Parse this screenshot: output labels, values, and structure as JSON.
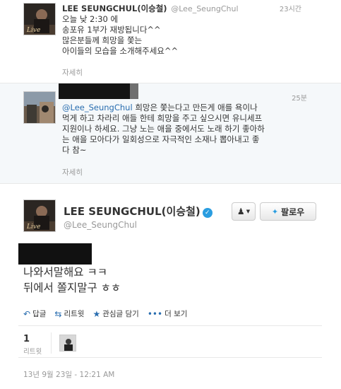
{
  "tweet1": {
    "name": "LEE SEUNGCHUL(이승철)",
    "handle": "@Lee_SeungChul",
    "time": "23시간",
    "lines": [
      "오늘 낮 2:30 에",
      "송포유 1부가 재방됩니다^^",
      "많은분들께 희망을 쫓는",
      "아이들의 모습을 소개해주세요^^"
    ],
    "more": "자세히"
  },
  "tweet2": {
    "time": "25분",
    "mention": "@Lee_SeungChul",
    "line1_rest": " 희망은 쫓는다고 만든게 애를 욕이나",
    "lines": [
      "먹게 하고 차라리 애들 한테 희망을 주고 싶으시면 유니세프",
      "지원이나 하세요. 그냥 노는 애을 중에서도 노래 하기 좋아하",
      "는 애을 모아다가 일회성으로 자극적인 소재나 뽑아내고 좋",
      "다 참~"
    ],
    "more": "자세히"
  },
  "main": {
    "name": "LEE SEUNGCHUL(이승철)",
    "verified_icon": "verified-check-icon",
    "handle": "@Lee_SeungChul",
    "follow_label": "팔로우",
    "lines": [
      "나와서말해요 ㅋㅋ",
      "뒤에서 쫄지말구 ㅎㅎ"
    ],
    "actions": {
      "reply": "답글",
      "retweet": "리트윗",
      "favorite": "관심글 담기",
      "more": "더 보기"
    },
    "retweet_count": "1",
    "retweet_label": "리트윗",
    "datetime": "13년 9월 23일 - 12:21 AM"
  },
  "colors": {
    "link": "#2a6eb0",
    "verified": "#2a9de0",
    "muted": "#999999"
  }
}
